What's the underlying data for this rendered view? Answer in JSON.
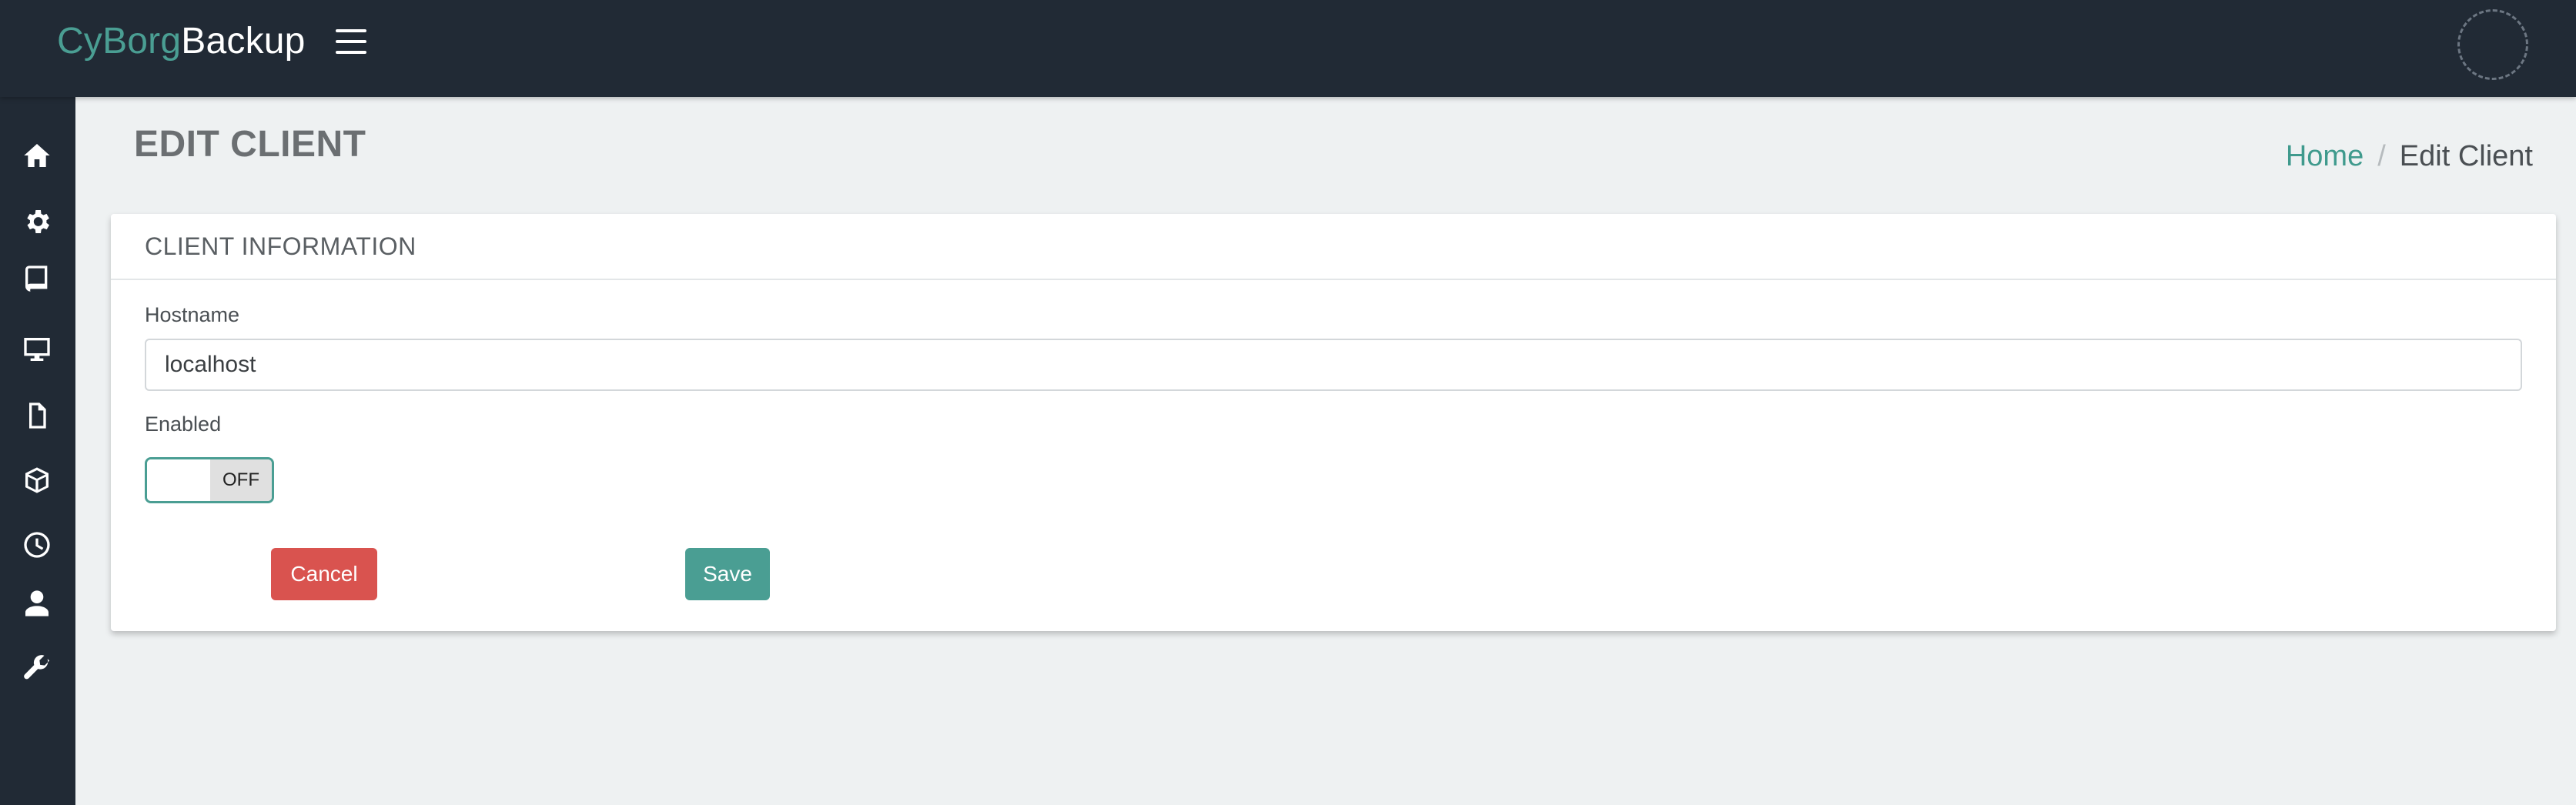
{
  "brand": {
    "part1": "CyBorg",
    "part2": "Backup"
  },
  "header": {
    "menu_icon": "hamburger-icon",
    "avatar_icon": "avatar"
  },
  "sidebar": {
    "items": [
      {
        "icon": "home-icon"
      },
      {
        "icon": "gear-icon"
      },
      {
        "icon": "book-icon"
      },
      {
        "icon": "desktop-icon"
      },
      {
        "icon": "file-icon"
      },
      {
        "icon": "cube-icon"
      },
      {
        "icon": "clock-icon"
      },
      {
        "icon": "user-icon"
      },
      {
        "icon": "wrench-icon"
      }
    ]
  },
  "page": {
    "title": "EDIT CLIENT"
  },
  "breadcrumb": {
    "home": "Home",
    "separator": "/",
    "current": "Edit Client"
  },
  "card": {
    "title": "CLIENT INFORMATION"
  },
  "form": {
    "hostname_label": "Hostname",
    "hostname_value": "localhost",
    "enabled_label": "Enabled",
    "enabled_state": "OFF",
    "cancel_label": "Cancel",
    "save_label": "Save"
  },
  "colors": {
    "accent": "#4a9e93",
    "danger": "#d9534f",
    "topbar": "#212a35",
    "background": "#eef1f2"
  }
}
